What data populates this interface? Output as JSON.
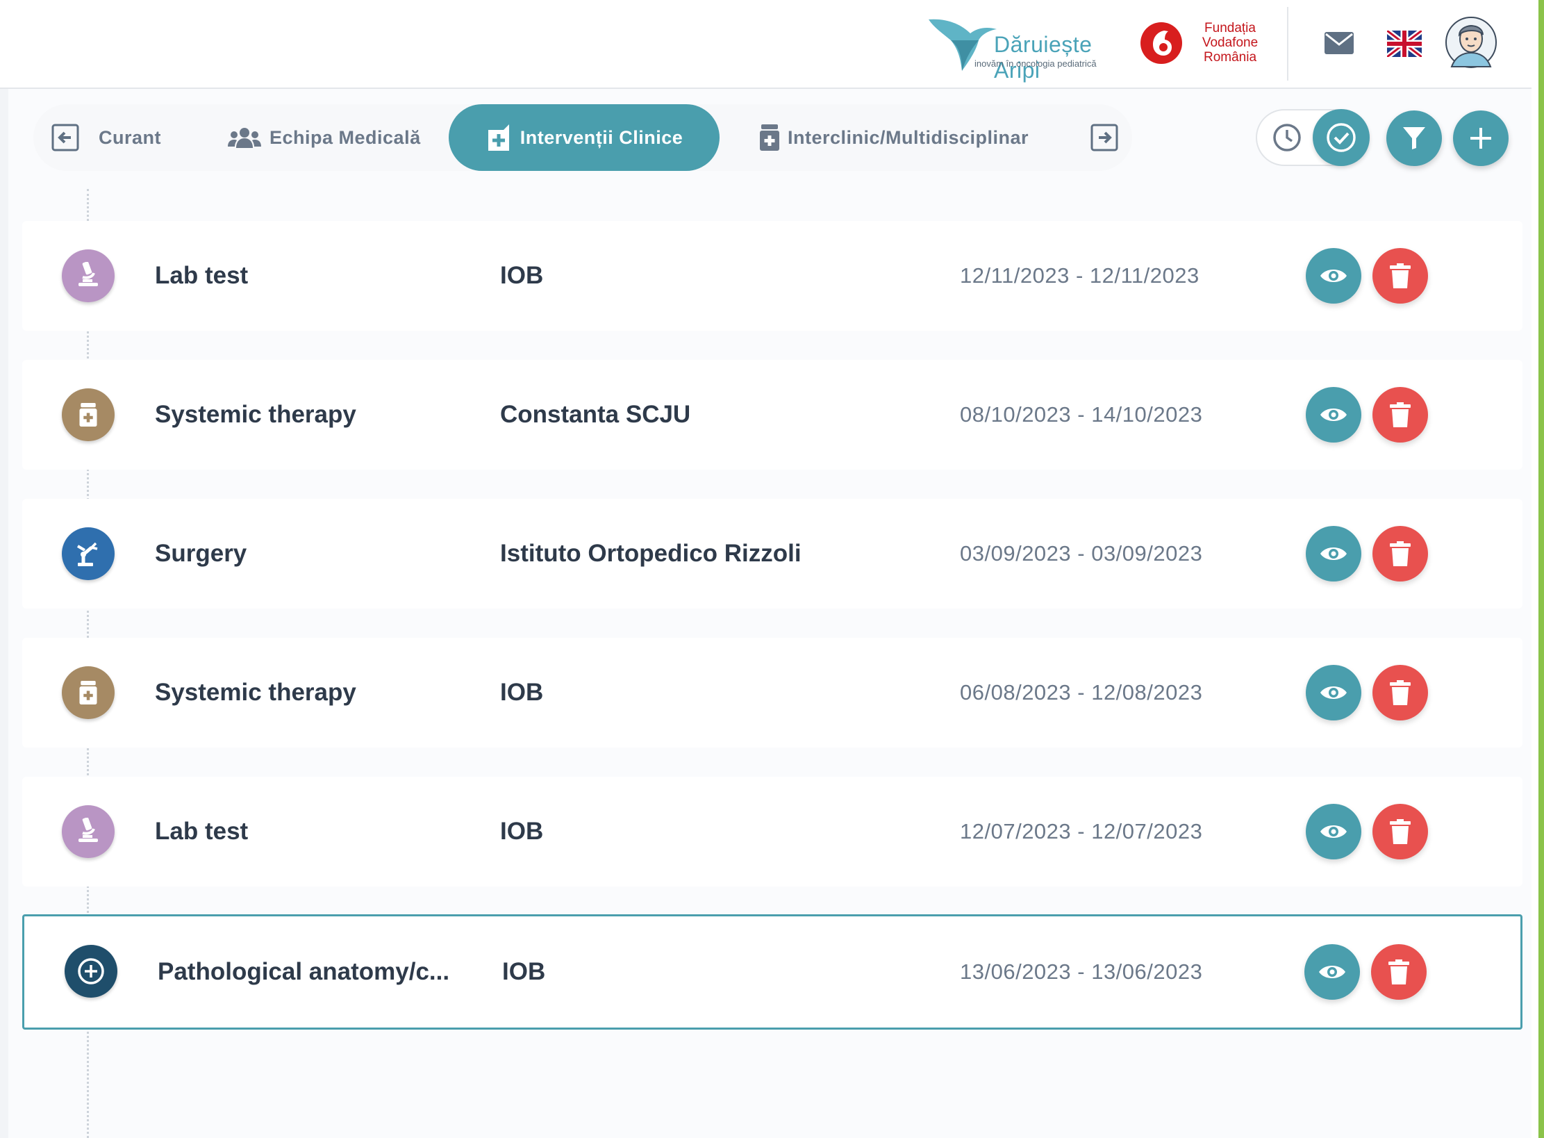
{
  "header": {
    "brand_name": "Dăruiește Aripi",
    "brand_tagline": "inovăm în oncologia pediatrică",
    "partner_name": "Fundația Vodafone România",
    "partner_lines": [
      "Fundația",
      "Vodafone",
      "România"
    ],
    "icons": [
      "hummingbird-logo",
      "vodafone-logo",
      "mail-icon",
      "uk-flag-icon",
      "user-avatar"
    ]
  },
  "tabs": {
    "items": [
      {
        "label": "Curant",
        "icon": "arrow-left-square-icon"
      },
      {
        "label": "Echipa Medicală",
        "icon": "users-icon"
      },
      {
        "label": "Intervenții Clinice",
        "icon": "clinic-cross-icon",
        "active": true
      },
      {
        "label": "Interclinic/Multidisciplinar",
        "icon": "medicine-bottle-icon"
      }
    ]
  },
  "controls": {
    "toggle_left_icon": "clock-icon",
    "toggle_right_icon": "check-icon",
    "filter_icon": "filter-icon",
    "add_icon": "plus-icon"
  },
  "colors": {
    "accent": "#4a9ead",
    "delete": "#e8514f",
    "lab": "#b995c4",
    "systemic": "#a68a64",
    "surgery": "#2f6fae",
    "pathology": "#1f4e6b"
  },
  "interventions": [
    {
      "type": "Lab test",
      "hospital": "IOB",
      "dates": "12/11/2023 - 12/11/2023",
      "icon": "microscope-icon"
    },
    {
      "type": "Systemic therapy",
      "hospital": "Constanta SCJU",
      "dates": "08/10/2023 - 14/10/2023",
      "icon": "medicine-bottle-icon"
    },
    {
      "type": "Surgery",
      "hospital": "Istituto Ortopedico Rizzoli",
      "dates": "03/09/2023 - 03/09/2023",
      "icon": "robot-arm-icon"
    },
    {
      "type": "Systemic therapy",
      "hospital": "IOB",
      "dates": "06/08/2023 - 12/08/2023",
      "icon": "medicine-bottle-icon"
    },
    {
      "type": "Lab test",
      "hospital": "IOB",
      "dates": "12/07/2023 - 12/07/2023",
      "icon": "microscope-icon"
    },
    {
      "type": "Pathological anatomy/c...",
      "hospital": "IOB",
      "dates": "13/06/2023 - 13/06/2023",
      "icon": "plus-circle-icon",
      "selected": true
    }
  ]
}
